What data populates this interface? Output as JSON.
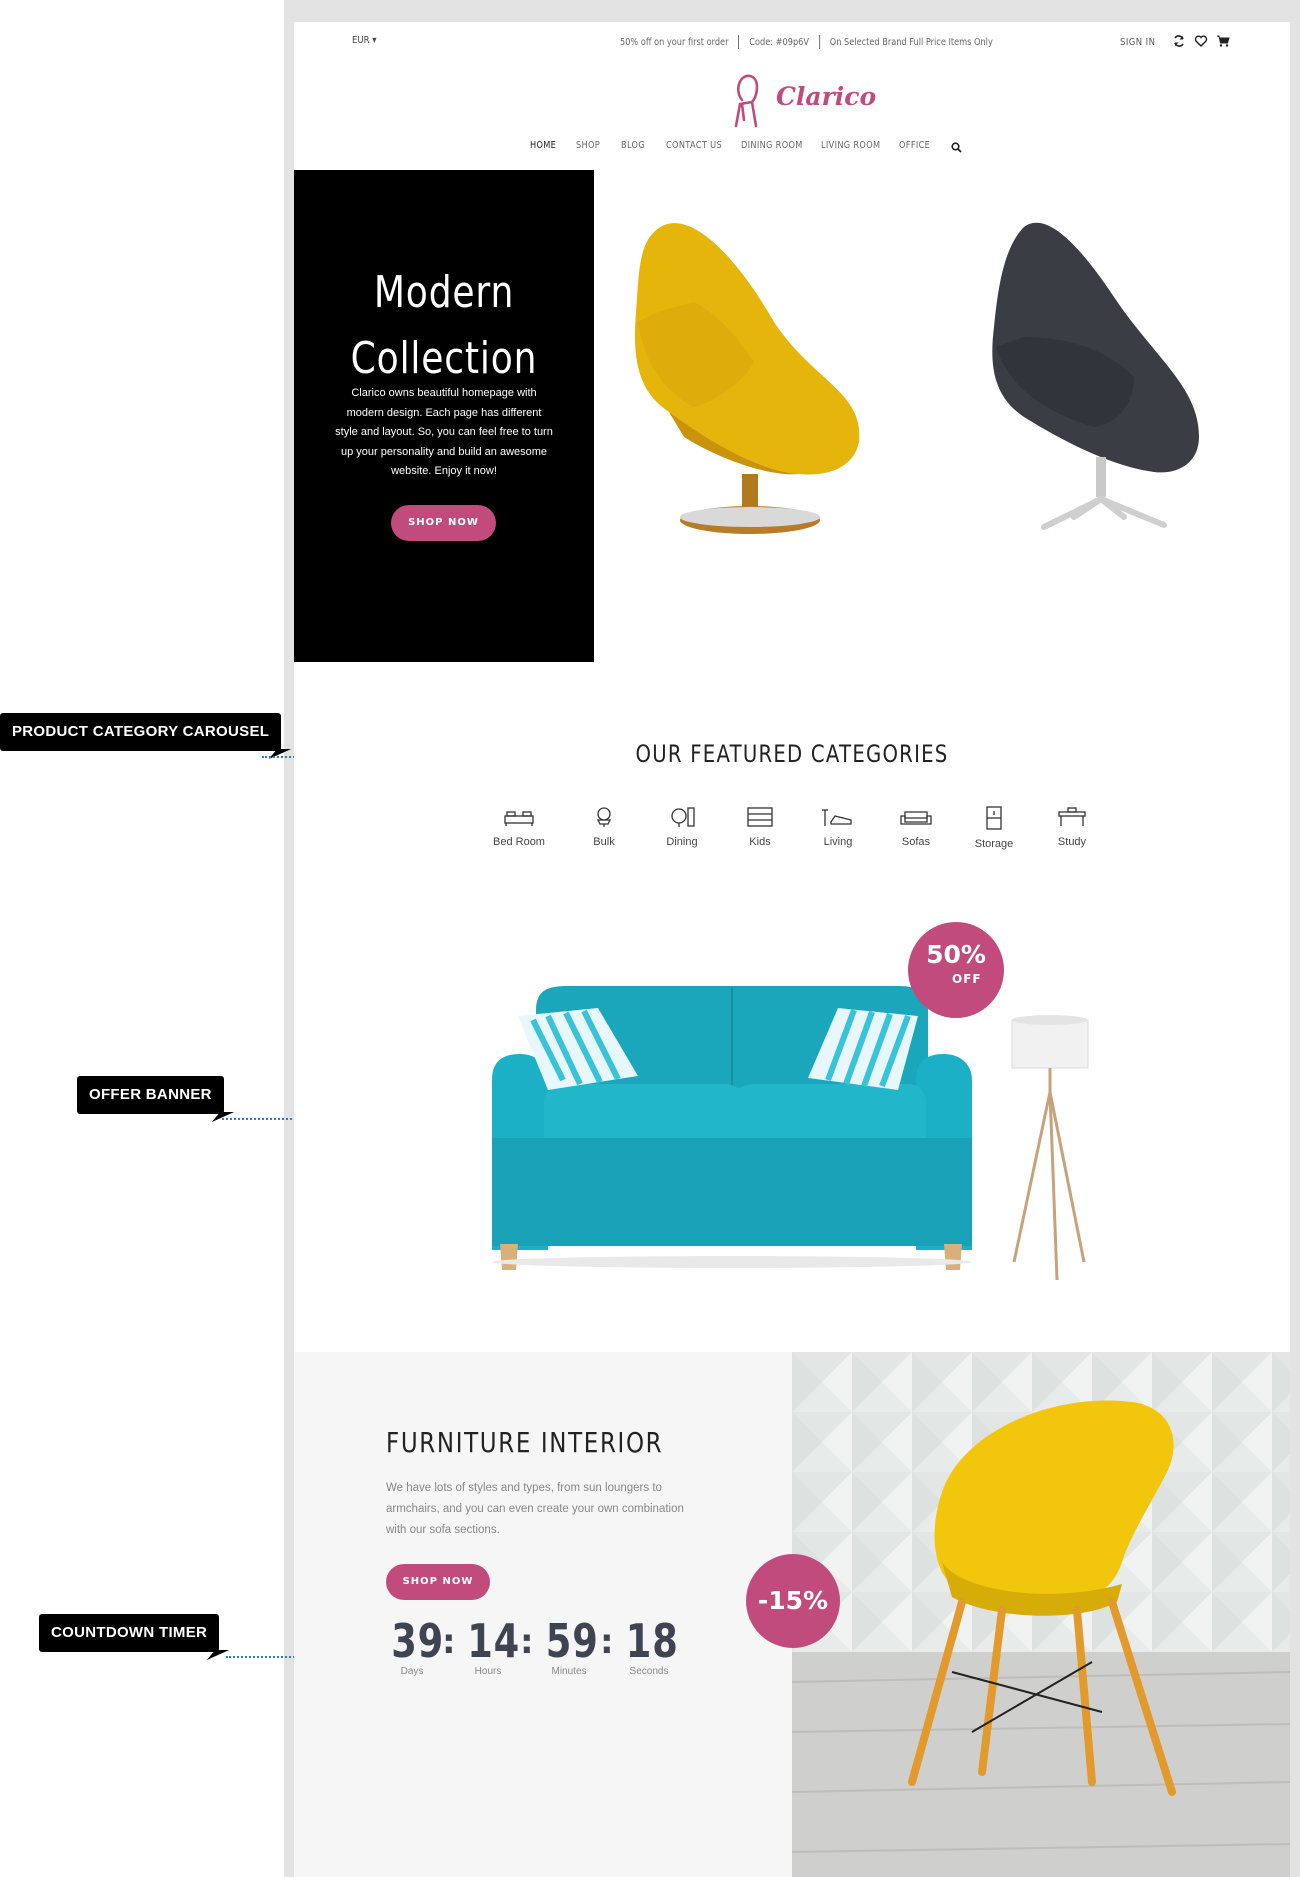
{
  "topbar": {
    "currency": "EUR",
    "promo": [
      "50% off on your first order",
      "Code: #09p6V",
      "On Selected Brand Full Price Items Only"
    ],
    "signin": "SIGN IN"
  },
  "logo": {
    "text": "Clarico"
  },
  "nav": [
    "HOME",
    "SHOP",
    "BLOG",
    "CONTACT US",
    "DINING ROOM",
    "LIVING ROOM",
    "OFFICE"
  ],
  "hero": {
    "title_line1": "Modern",
    "title_line2": "Collection",
    "description": "Clarico owns beautiful homepage with modern design. Each page has different style and layout. So, you can feel free to turn up your personality and build an awesome website. Enjoy it now!",
    "button": "SHOP NOW"
  },
  "categories": {
    "title": "OUR FEATURED CATEGORIES",
    "items": [
      "Bed Room",
      "Bulk",
      "Dining",
      "Kids",
      "Living",
      "Sofas",
      "Storage",
      "Study"
    ]
  },
  "offer": {
    "percent": "50%",
    "label": "OFF"
  },
  "interior": {
    "title": "FURNITURE INTERIOR",
    "description": "We have lots of styles and types, from sun loungers to armchairs, and you can even create your own combination with our sofa sections.",
    "button": "SHOP NOW",
    "discount": "-15%"
  },
  "countdown": {
    "days": "39",
    "hours": "14",
    "minutes": "59",
    "seconds": "18",
    "labels": {
      "days": "Days",
      "hours": "Hours",
      "minutes": "Minutes",
      "seconds": "Seconds"
    }
  },
  "callouts": {
    "carousel": "PRODUCT CATEGORY CAROUSEL",
    "offer": "OFFER BANNER",
    "timer": "COUNTDOWN TIMER"
  },
  "colors": {
    "accent": "#c14b7c",
    "hero_bg": "#000000",
    "annotation_line": "#2b7bd6"
  },
  "icons": [
    "caret-down-icon",
    "refresh-icon",
    "heart-icon",
    "cart-icon",
    "search-icon",
    "chair-logo-icon"
  ]
}
